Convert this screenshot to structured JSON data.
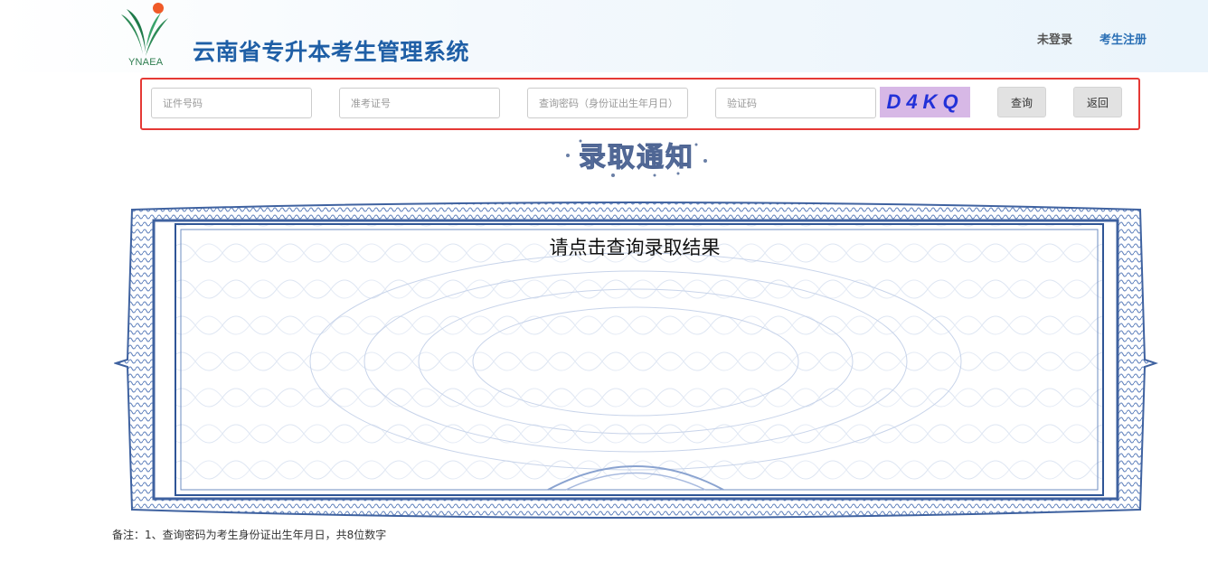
{
  "header": {
    "logo_text": "YNAEA",
    "site_title": "云南省专升本考生管理系统",
    "login_status": "未登录",
    "register_link": "考生注册"
  },
  "search": {
    "id_number_placeholder": "证件号码",
    "exam_number_placeholder": "准考证号",
    "password_placeholder": "查询密码（身份证出生年月日）",
    "captcha_placeholder": "验证码",
    "captcha_code": "D4KQ",
    "query_button": "查询",
    "back_button": "返回"
  },
  "main": {
    "notice_title": "录取通知",
    "result_prompt": "请点击查询录取结果"
  },
  "footnote": "备注：1、查询密码为考生身份证出生年月日，共8位数字",
  "colors": {
    "brand_blue": "#1f5fa6",
    "highlight_border": "#e53935",
    "captcha_bg": "#d7b8e6",
    "captcha_text": "#2231d8",
    "certificate_border": "#3f62a0"
  }
}
